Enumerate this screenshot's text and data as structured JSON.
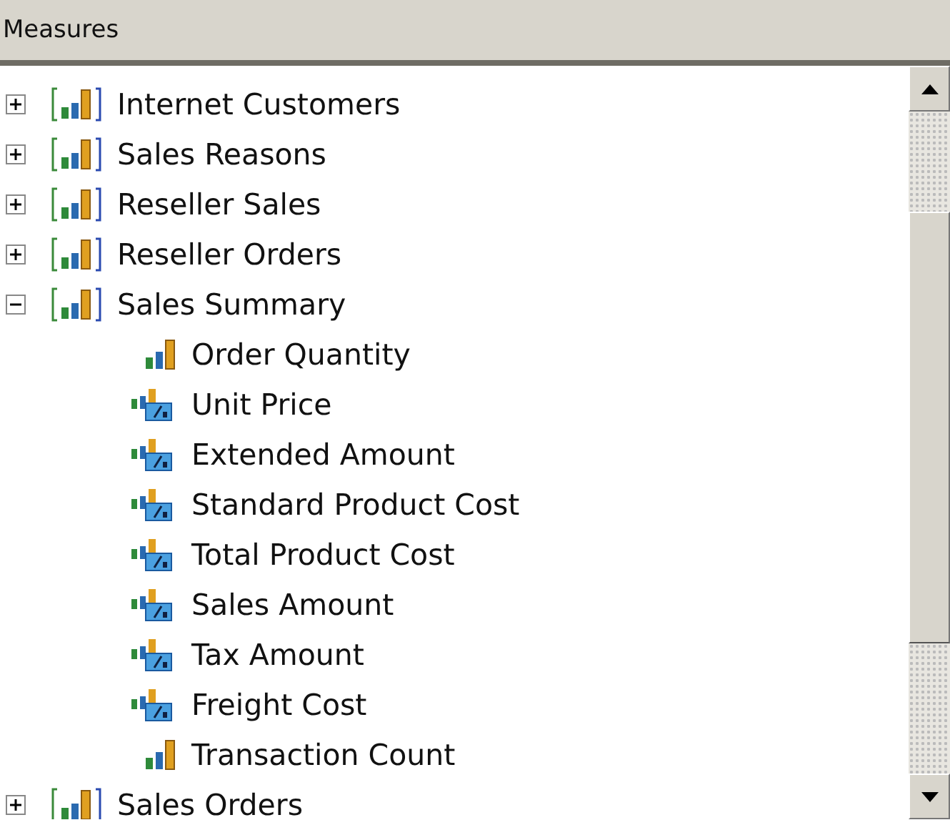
{
  "header": {
    "title": "Measures"
  },
  "tree": [
    {
      "label": "Internet Customers",
      "expanded": false
    },
    {
      "label": "Sales Reasons",
      "expanded": false
    },
    {
      "label": "Reseller Sales",
      "expanded": false
    },
    {
      "label": "Reseller Orders",
      "expanded": false
    },
    {
      "label": "Sales Summary",
      "expanded": true,
      "children": [
        {
          "label": "Order Quantity",
          "kind": "measure"
        },
        {
          "label": "Unit Price",
          "kind": "calculated"
        },
        {
          "label": "Extended Amount",
          "kind": "calculated"
        },
        {
          "label": "Standard Product Cost",
          "kind": "calculated"
        },
        {
          "label": "Total Product Cost",
          "kind": "calculated"
        },
        {
          "label": "Sales Amount",
          "kind": "calculated"
        },
        {
          "label": "Tax Amount",
          "kind": "calculated"
        },
        {
          "label": "Freight Cost",
          "kind": "calculated"
        },
        {
          "label": "Transaction Count",
          "kind": "measure"
        }
      ]
    },
    {
      "label": "Sales Orders",
      "expanded": false
    }
  ]
}
